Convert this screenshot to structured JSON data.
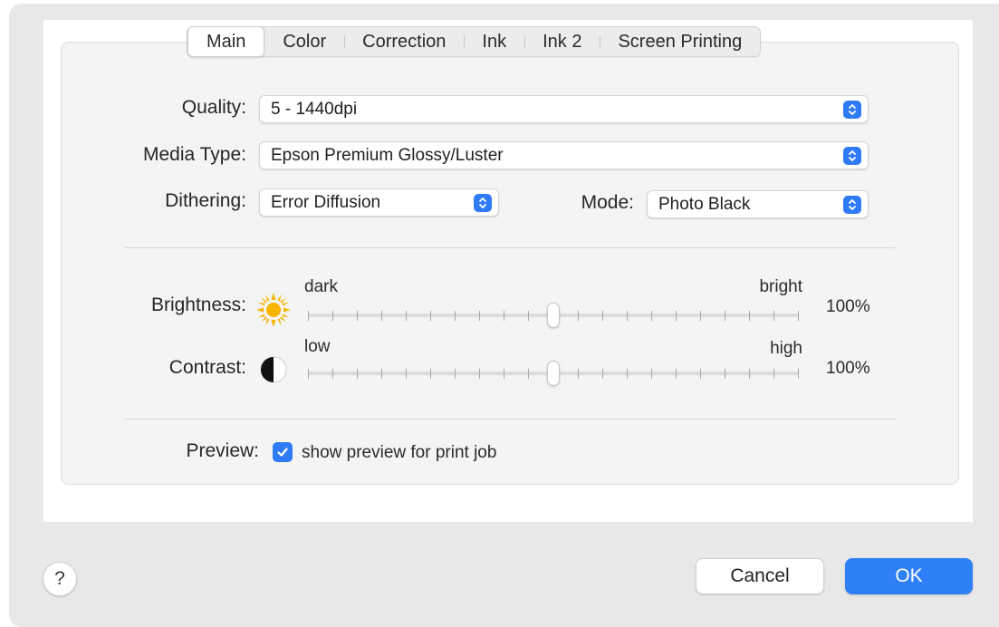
{
  "tabs": [
    {
      "label": "Main",
      "active": true
    },
    {
      "label": "Color",
      "active": false
    },
    {
      "label": "Correction",
      "active": false
    },
    {
      "label": "Ink",
      "active": false
    },
    {
      "label": "Ink 2",
      "active": false
    },
    {
      "label": "Screen Printing",
      "active": false
    }
  ],
  "quality": {
    "label": "Quality:",
    "value": "5 - 1440dpi"
  },
  "media_type": {
    "label": "Media Type:",
    "value": "Epson Premium Glossy/Luster"
  },
  "dithering": {
    "label": "Dithering:",
    "value": "Error Diffusion"
  },
  "mode": {
    "label": "Mode:",
    "value": "Photo Black"
  },
  "brightness": {
    "label": "Brightness:",
    "min_label": "dark",
    "max_label": "bright",
    "value_text": "100%",
    "icon": "sun-icon",
    "position": 0.5
  },
  "contrast": {
    "label": "Contrast:",
    "min_label": "low",
    "max_label": "high",
    "value_text": "100%",
    "icon": "contrast-icon",
    "position": 0.5
  },
  "preview": {
    "label": "Preview:",
    "checkbox_label": "show preview for print job",
    "checked": true
  },
  "buttons": {
    "help": "?",
    "cancel": "Cancel",
    "ok": "OK"
  },
  "colors": {
    "accent": "#2f7bf6",
    "sun": "#f7b500"
  }
}
